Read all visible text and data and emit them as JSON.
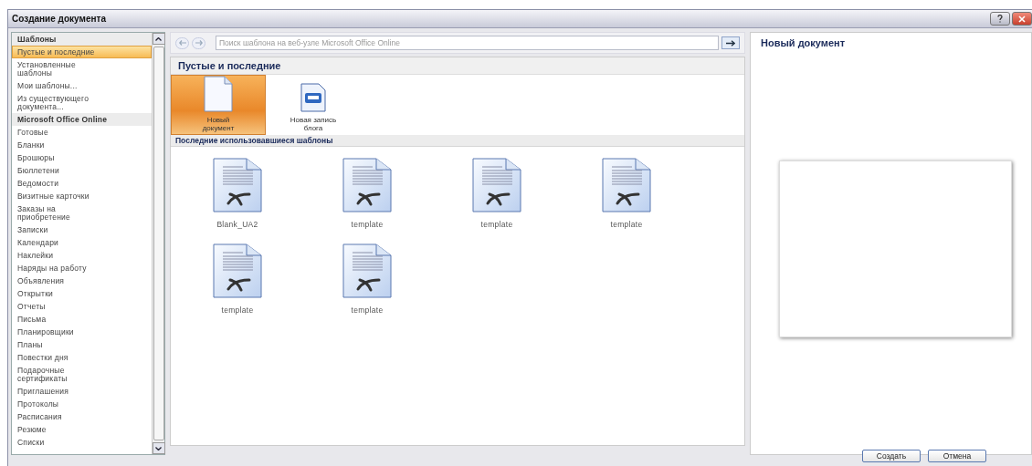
{
  "window": {
    "title": "Создание документа"
  },
  "sidebar": {
    "items": [
      {
        "kind": "header",
        "label": "Шаблоны",
        "selected": false
      },
      {
        "kind": "item",
        "label": "Пустые и последние",
        "selected": true
      },
      {
        "kind": "item",
        "label": "Установленные шаблоны",
        "selected": false
      },
      {
        "kind": "item",
        "label": "Мои шаблоны...",
        "selected": false
      },
      {
        "kind": "item",
        "label": "Из существующего документа...",
        "selected": false
      },
      {
        "kind": "header",
        "label": "Microsoft Office Online",
        "selected": false
      },
      {
        "kind": "item",
        "label": "Готовые",
        "selected": false
      },
      {
        "kind": "item",
        "label": "Бланки",
        "selected": false
      },
      {
        "kind": "item",
        "label": "Брошюры",
        "selected": false
      },
      {
        "kind": "item",
        "label": "Бюллетени",
        "selected": false
      },
      {
        "kind": "item",
        "label": "Ведомости",
        "selected": false
      },
      {
        "kind": "item",
        "label": "Визитные карточки",
        "selected": false
      },
      {
        "kind": "item",
        "label": "Заказы на приобретение",
        "selected": false
      },
      {
        "kind": "item",
        "label": "Записки",
        "selected": false
      },
      {
        "kind": "item",
        "label": "Календари",
        "selected": false
      },
      {
        "kind": "item",
        "label": "Наклейки",
        "selected": false
      },
      {
        "kind": "item",
        "label": "Наряды на работу",
        "selected": false
      },
      {
        "kind": "item",
        "label": "Объявления",
        "selected": false
      },
      {
        "kind": "item",
        "label": "Открытки",
        "selected": false
      },
      {
        "kind": "item",
        "label": "Отчеты",
        "selected": false
      },
      {
        "kind": "item",
        "label": "Письма",
        "selected": false
      },
      {
        "kind": "item",
        "label": "Планировщики",
        "selected": false
      },
      {
        "kind": "item",
        "label": "Планы",
        "selected": false
      },
      {
        "kind": "item",
        "label": "Повестки дня",
        "selected": false
      },
      {
        "kind": "item",
        "label": "Подарочные сертификаты",
        "selected": false
      },
      {
        "kind": "item",
        "label": "Приглашения",
        "selected": false
      },
      {
        "kind": "item",
        "label": "Протоколы",
        "selected": false
      },
      {
        "kind": "item",
        "label": "Расписания",
        "selected": false
      },
      {
        "kind": "item",
        "label": "Резюме",
        "selected": false
      },
      {
        "kind": "item",
        "label": "Списки",
        "selected": false
      }
    ]
  },
  "search": {
    "placeholder": "Поиск шаблона на веб-узле Microsoft Office Online"
  },
  "main": {
    "title": "Пустые и последние",
    "tiles": [
      {
        "kind": "blank",
        "label": "Новый документ",
        "selected": true
      },
      {
        "kind": "blog",
        "label": "Новая запись блога",
        "selected": false
      }
    ],
    "recent_title": "Последние использовавшиеся шаблоны",
    "recent": [
      {
        "label": "Blank_UA2"
      },
      {
        "label": "template"
      },
      {
        "label": "template"
      },
      {
        "label": "template"
      },
      {
        "label": "template"
      },
      {
        "label": "template"
      }
    ]
  },
  "preview": {
    "title": "Новый документ"
  },
  "buttons": [
    "Создать",
    "Отмена"
  ]
}
